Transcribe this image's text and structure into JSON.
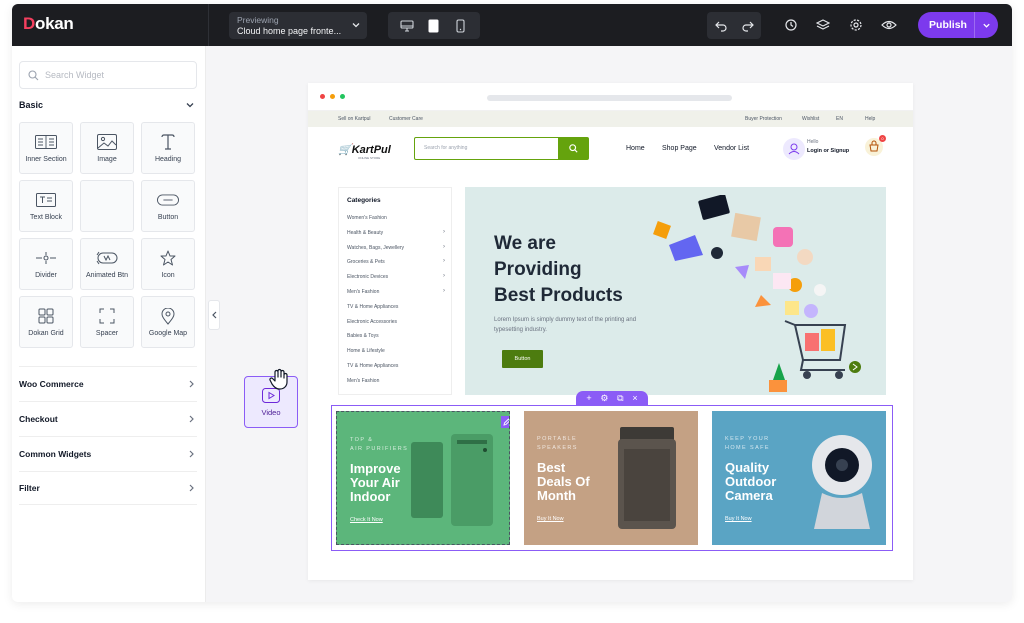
{
  "app": {
    "logo_initial": "D",
    "logo_rest": "okan",
    "preview_label": "Previewing",
    "preview_value": "Cloud home page fronte...",
    "publish_label": "Publish",
    "accent_color": "#7c3aed"
  },
  "toolbar_icons": [
    "desktop-icon",
    "tablet-icon",
    "mobile-icon",
    "undo-icon",
    "redo-icon",
    "history-icon",
    "layers-icon",
    "settings-icon",
    "eye-icon",
    "chevron-down-icon"
  ],
  "sidebar": {
    "search_placeholder": "Search Widget",
    "basic_title": "Basic",
    "widgets": [
      {
        "label": "Inner Section",
        "icon": "inner-section-icon"
      },
      {
        "label": "Image",
        "icon": "image-icon"
      },
      {
        "label": "Heading",
        "icon": "heading-icon"
      },
      {
        "label": "Text Block",
        "icon": "text-block-icon"
      },
      {
        "label": "",
        "icon": ""
      },
      {
        "label": "Button",
        "icon": "button-icon"
      },
      {
        "label": "Divider",
        "icon": "divider-icon"
      },
      {
        "label": "Animated Btn",
        "icon": "animated-button-icon"
      },
      {
        "label": "Icon",
        "icon": "star-icon"
      },
      {
        "label": "Dokan Grid",
        "icon": "grid-icon"
      },
      {
        "label": "Spacer",
        "icon": "spacer-icon"
      },
      {
        "label": "Google Map",
        "icon": "map-pin-icon"
      }
    ],
    "sections": [
      "Woo Commerce",
      "Checkout",
      "Common Widgets",
      "Filter"
    ]
  },
  "dragging": {
    "label": "Video",
    "icon": "video-icon"
  },
  "site": {
    "topbar_left": [
      "Sell on Kartpul",
      "Customer Care"
    ],
    "topbar_right": [
      "Buyer Protection",
      "Wishlist",
      "EN",
      "Help"
    ],
    "logo_part1": "Kart",
    "logo_part2": "Pul",
    "logo_tagline": "ONLINE STORE",
    "search_placeholder": "Search for anything",
    "nav": [
      "Home",
      "Shop Page",
      "Vendor List"
    ],
    "hello": "Hello",
    "login": "Login or Signup",
    "cart_count": "0",
    "categories_title": "Categories",
    "categories": [
      {
        "label": "Women's Fashion",
        "arrow": false
      },
      {
        "label": "Health & Beauty",
        "arrow": true
      },
      {
        "label": "Watches, Bags, Jewellery",
        "arrow": true
      },
      {
        "label": "Groceries & Pets",
        "arrow": true
      },
      {
        "label": "Electronic Devices",
        "arrow": true
      },
      {
        "label": "Men's Fashion",
        "arrow": true
      },
      {
        "label": "TV & Home Appliances",
        "arrow": false
      },
      {
        "label": "Electronic Accessories",
        "arrow": false
      },
      {
        "label": "Babies & Toys",
        "arrow": false
      },
      {
        "label": "Home & Lifestyle",
        "arrow": false
      },
      {
        "label": "TV & Home Appliances",
        "arrow": false
      },
      {
        "label": "Men's Fashion",
        "arrow": false
      }
    ],
    "hero_title": "We are\nProviding\nBest Products",
    "hero_sub": "Lorem Ipsum is simply dummy text of the printing and typesetting industry.",
    "hero_button": "Button",
    "promos": [
      {
        "pre": "TOP &\nAIR PURIFIERS",
        "title": "Improve\nYour Air\nIndoor",
        "link": "Check It Now",
        "color": "#5cb67b"
      },
      {
        "pre": "PORTABLE\nSPEAKERS",
        "title": "Best\nDeals Of\nMonth",
        "link": "Buy It Now",
        "color": "#c4a184"
      },
      {
        "pre": "KEEP YOUR\nHOME SAFE",
        "title": "Quality\nOutdoor\nCamera",
        "link": "Buy It Now",
        "color": "#5aa4c4"
      }
    ]
  }
}
